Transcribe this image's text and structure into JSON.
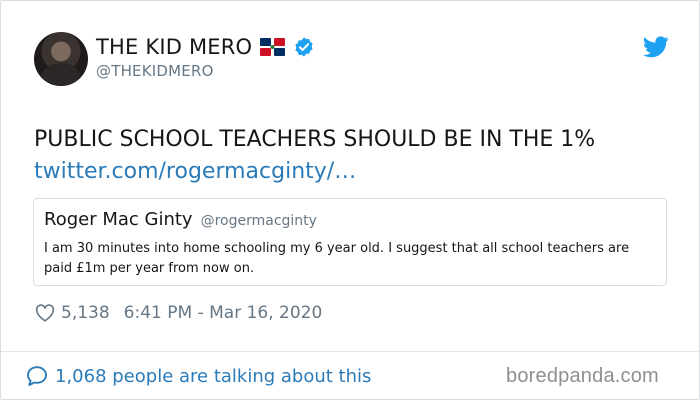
{
  "tweet": {
    "author": {
      "display_name": "THE KID MERO",
      "handle": "@THEKIDMERO",
      "flag_icon": "dominican-republic-flag",
      "verified": true
    },
    "text": "PUBLIC SCHOOL TEACHERS SHOULD BE IN THE 1%",
    "link_text": "twitter.com/rogermacginty/…",
    "quoted_tweet": {
      "display_name": "Roger Mac Ginty",
      "handle": "@rogermacginty",
      "text": "I am 30 minutes into home schooling my 6 year old. I suggest that all school teachers are paid £1m per year from now on."
    },
    "likes": "5,138",
    "timestamp": "6:41 PM - Mar 16, 2020",
    "talking_about": "1,068 people are talking about this"
  },
  "watermark": "boredpanda.com",
  "colors": {
    "link": "#2b7bb9",
    "twitter_blue": "#1da1f2",
    "muted": "#657786",
    "border": "#d6dde3"
  },
  "icons": [
    "twitter-bird-icon",
    "verified-badge-icon",
    "heart-icon",
    "speech-bubble-icon"
  ]
}
